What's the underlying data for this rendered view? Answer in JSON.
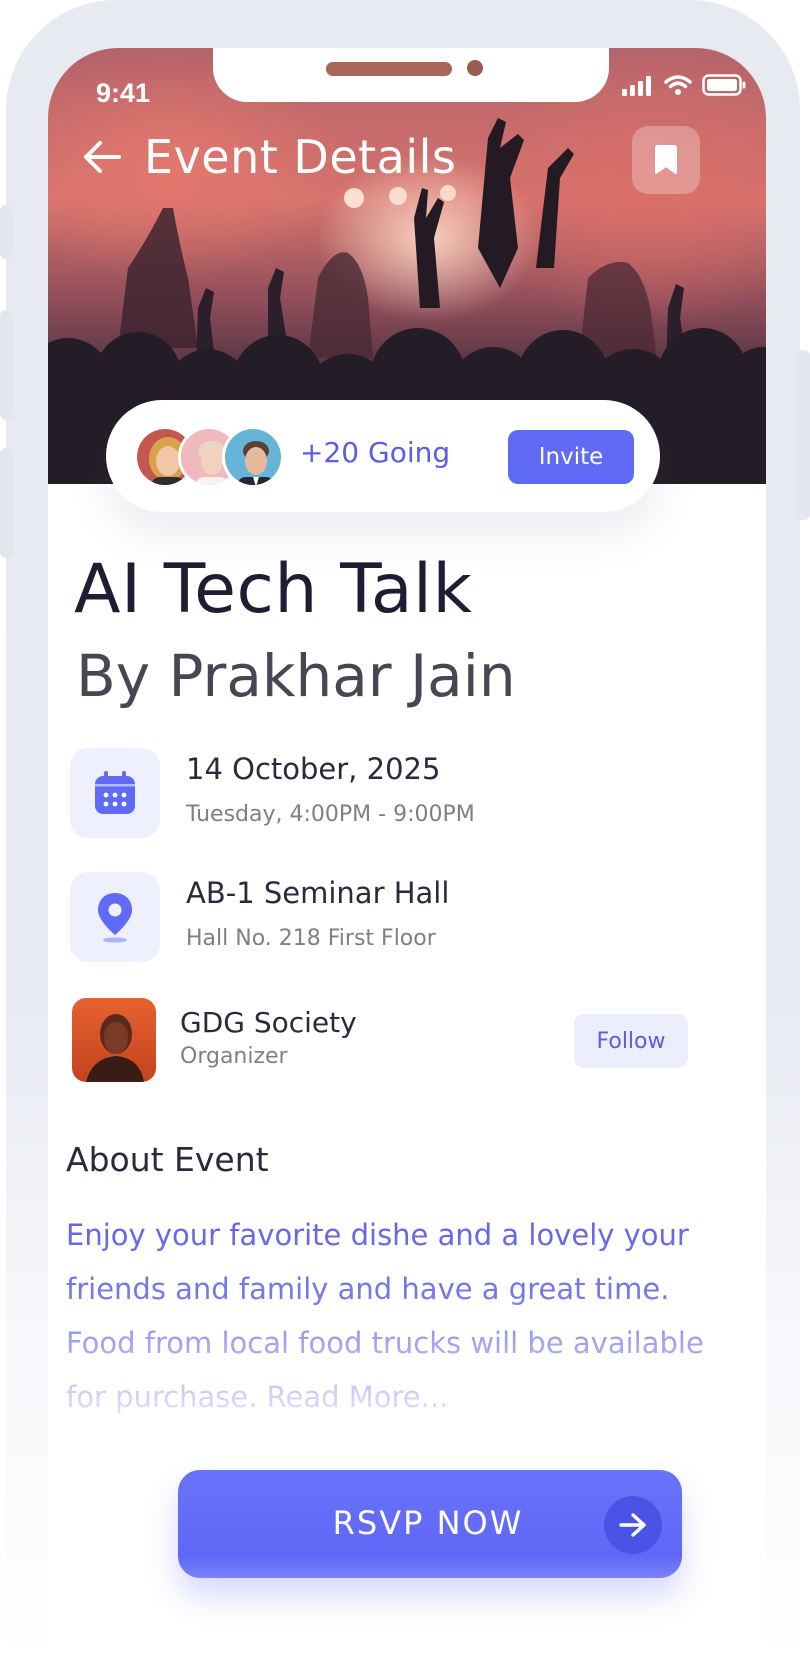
{
  "status_bar": {
    "time": "9:41"
  },
  "header": {
    "title": "Event Details"
  },
  "attendance": {
    "going_label": "+20 Going",
    "invite_label": "Invite"
  },
  "event": {
    "title": "AI Tech Talk",
    "subtitle": "By Prakhar Jain",
    "date": "14 October, 2025",
    "time": "Tuesday, 4:00PM - 9:00PM",
    "venue": "AB-1 Seminar Hall",
    "venue_detail": "Hall No. 218 First Floor"
  },
  "organizer": {
    "name": "GDG Society",
    "role": "Organizer",
    "follow_label": "Follow"
  },
  "about": {
    "title": "About Event",
    "text": "Enjoy your favorite dishe and a lovely your friends and family and have a great time. Food from local food trucks will be available for purchase.",
    "read_more": "Read More..."
  },
  "cta": {
    "label": "RSVP NOW"
  },
  "colors": {
    "accent": "#5f6af5",
    "accent_text": "#5b5ce8",
    "title_text": "#1e1d33",
    "icon_bg": "#eef0fd"
  },
  "icons": [
    "back-arrow-icon",
    "bookmark-icon",
    "calendar-icon",
    "location-pin-icon",
    "arrow-right-icon",
    "signal-icon",
    "wifi-icon",
    "battery-icon"
  ]
}
